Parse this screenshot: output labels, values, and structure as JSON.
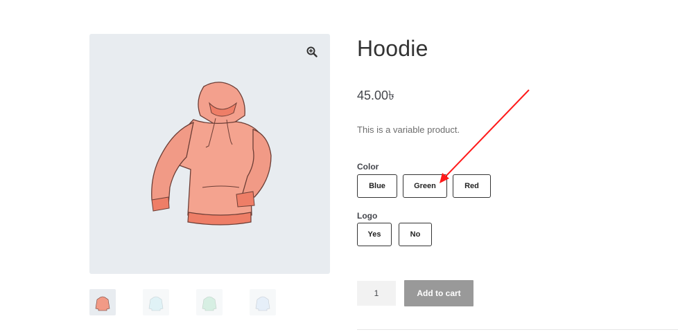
{
  "product": {
    "title": "Hoodie",
    "price": "45.00৳",
    "description": "This is a variable product."
  },
  "gallery": {
    "zoom_icon": "magnifier-plus-icon",
    "main_image": "hoodie-illustration",
    "thumbnails": [
      "pink hoodie",
      "blue hoodie",
      "green hoodie",
      "light blue hoodie"
    ]
  },
  "attributes": {
    "color": {
      "label": "Color",
      "options": [
        "Blue",
        "Green",
        "Red"
      ]
    },
    "logo": {
      "label": "Logo",
      "options": [
        "Yes",
        "No"
      ]
    }
  },
  "cart": {
    "quantity": "1",
    "button_label": "Add to cart"
  },
  "annotation": {
    "arrow_color": "#ff1a1a"
  }
}
